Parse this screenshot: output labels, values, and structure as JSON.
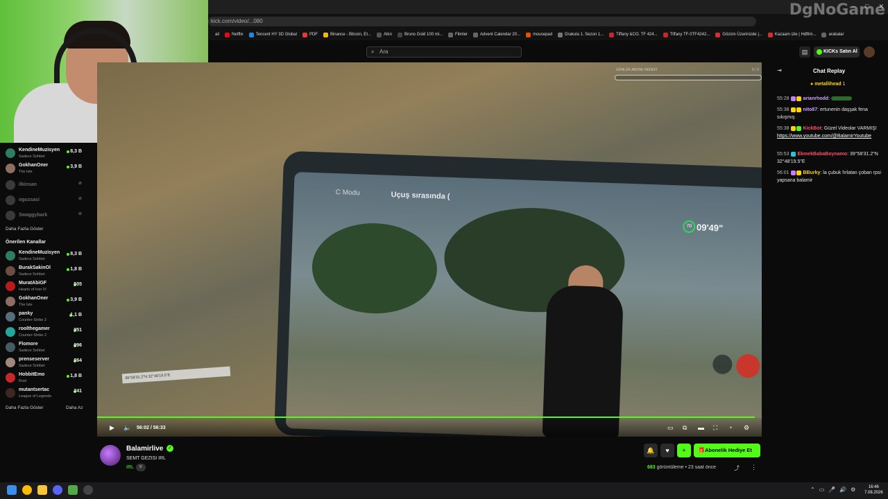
{
  "browser": {
    "address": "kick.com/video/...080",
    "bookmarks": [
      "ail",
      "Netflix",
      "Tencent HY 3D Global",
      "PDF",
      "Binance - Bitcoin, Et...",
      "Altın",
      "Bruno Gold 100 ml...",
      "Filmler",
      "Advent Calendar 20...",
      "mousepad",
      "Drakula 1. Sezon 1...",
      "Tiffany &CO. TF 424...",
      "Tiffany TF-0TF4242...",
      "Gözüm Üzerinizde |...",
      "Kazaam izle | Hdfilm...",
      "arabalar"
    ],
    "window_buttons": [
      "–",
      "□",
      "✕"
    ],
    "watermark": "DgNoGame"
  },
  "header": {
    "search_placeholder": "Ara",
    "kicks_button": "KICKs Satın Al"
  },
  "sidebar": {
    "following": [
      {
        "name": "KendineMuzisyen",
        "game": "Sadece Sohbet",
        "viewers": "8,3 B",
        "live": true
      },
      {
        "name": "GokhanOner",
        "game": "The Isle",
        "viewers": "3,9 B",
        "live": true
      },
      {
        "name": "ilkinsan",
        "game": "",
        "viewers": "",
        "live": false
      },
      {
        "name": "oguzsasi",
        "game": "",
        "viewers": "",
        "live": false
      },
      {
        "name": "Swaggybark",
        "game": "",
        "viewers": "",
        "live": false
      }
    ],
    "show_more": "Daha Fazla Göster",
    "recommended_title": "Önerilen Kanallar",
    "recommended": [
      {
        "name": "KendineMuzisyen",
        "game": "Sadece Sohbet",
        "viewers": "8,3 B"
      },
      {
        "name": "BurakSakinOl",
        "game": "Sadece Sohbet",
        "viewers": "1,8 B"
      },
      {
        "name": "MuratAbiGF",
        "game": "Hearts of Iron IV",
        "viewers": "505"
      },
      {
        "name": "GokhanOner",
        "game": "The Isle",
        "viewers": "3,9 B"
      },
      {
        "name": "panky",
        "game": "Counter-Strike 2",
        "viewers": "1,1 B"
      },
      {
        "name": "roolthegamer",
        "game": "Counter-Strike 2",
        "viewers": "951"
      },
      {
        "name": "Flomore",
        "game": "Sadece Sohbet",
        "viewers": "996"
      },
      {
        "name": "prenseserver",
        "game": "Sadece Sohbet",
        "viewers": "864"
      },
      {
        "name": "HobbitEmo",
        "game": "Rust",
        "viewers": "1,8 B"
      },
      {
        "name": "mutantsertac",
        "game": "League of Legends",
        "viewers": "241"
      }
    ],
    "show_more_2": "Daha Fazla Göster",
    "show_less": "Daha Az"
  },
  "video": {
    "screen_mode": "C Modu",
    "screen_flight": "Uçuş sırasında (",
    "screen_time": "09'49\"",
    "screen_badge": "70",
    "goal_label": "GÜNLÜK ABONE HEDEFİ",
    "goal_count": "0 / 3",
    "gps_overlay": "39°58'31.2\"N 32°48'19.5\"E",
    "timecode": "56:02 / 56:33",
    "progress": 0.99
  },
  "stream_info": {
    "channel": "Balamirlive",
    "title": "SEMT GEZISI IRL",
    "category": "IRL",
    "language": "tr",
    "subscribe_gift": "Abonelik Hediye Et",
    "viewers": "683",
    "views_label": "görüntüleme",
    "ago": "23 saat önce"
  },
  "chat": {
    "title": "Chat Replay",
    "pinned_user": "metallihead",
    "pinned_count": "1",
    "messages": [
      {
        "time": "55:28",
        "user": "arianrhodd",
        "color": "#c9a2ff",
        "text": ""
      },
      {
        "time": "55:38",
        "user": "nito87",
        "color": "#c9a2ff",
        "text": "ertunenin daşşak fena sıkışmış"
      },
      {
        "time": "55:38",
        "user": "KickBot",
        "color": "#53fc18",
        "text": "Güzel Videolar VARMIŞ!",
        "link": "https://www.youtube.com/@BalamirYoutube"
      },
      {
        "time": "55:53",
        "user": "EkmekBabaBoynamo",
        "color": "#ff4d6d",
        "text": "39°58'31.2\"N 32°48'19.5\"E"
      },
      {
        "time": "56:01",
        "user": "BBurky",
        "color": "#ffd400",
        "text": "la çubuk fırlatan çoban rpsi yapsana balamir"
      }
    ]
  },
  "taskbar": {
    "clock_time": "16:46",
    "clock_date": "7.08.2026"
  },
  "colors": {
    "accent": "#53fc18",
    "bg": "#0b0b0c"
  }
}
